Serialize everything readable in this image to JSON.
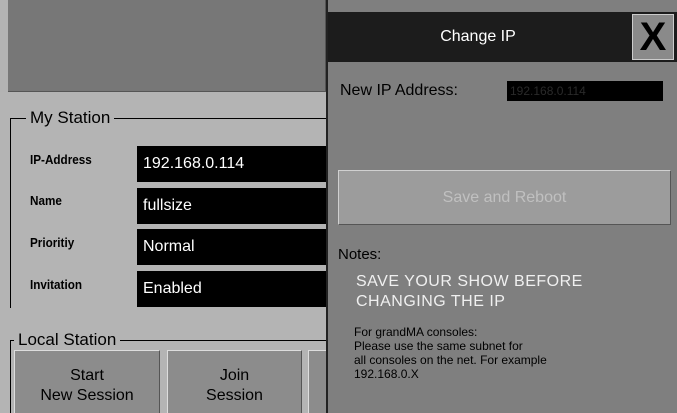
{
  "my_station": {
    "title": "My Station",
    "rows": [
      {
        "label": "IP-Address",
        "value": "192.168.0.114"
      },
      {
        "label": "Name",
        "value": "fullsize"
      },
      {
        "label": "Prioritiy",
        "value": "Normal"
      },
      {
        "label": "Invitation",
        "value": "Enabled"
      }
    ]
  },
  "local_station": {
    "title": "Local Station",
    "buttons": [
      {
        "line1": "Start",
        "line2": "New Session"
      },
      {
        "line1": "Join",
        "line2": "Session"
      }
    ]
  },
  "dialog": {
    "title": "Change IP",
    "close_label": "X",
    "ip_label": "New IP Address:",
    "ip_value": "192.168.0.114",
    "save_label": "Save and Reboot",
    "notes_label": "Notes:",
    "warning_line1": "SAVE YOUR SHOW BEFORE",
    "warning_line2": "CHANGING THE IP",
    "info_text": "For grandMA consoles:\nPlease use the same subnet for\nall consoles on the net. For example\n192.168.0.X"
  }
}
